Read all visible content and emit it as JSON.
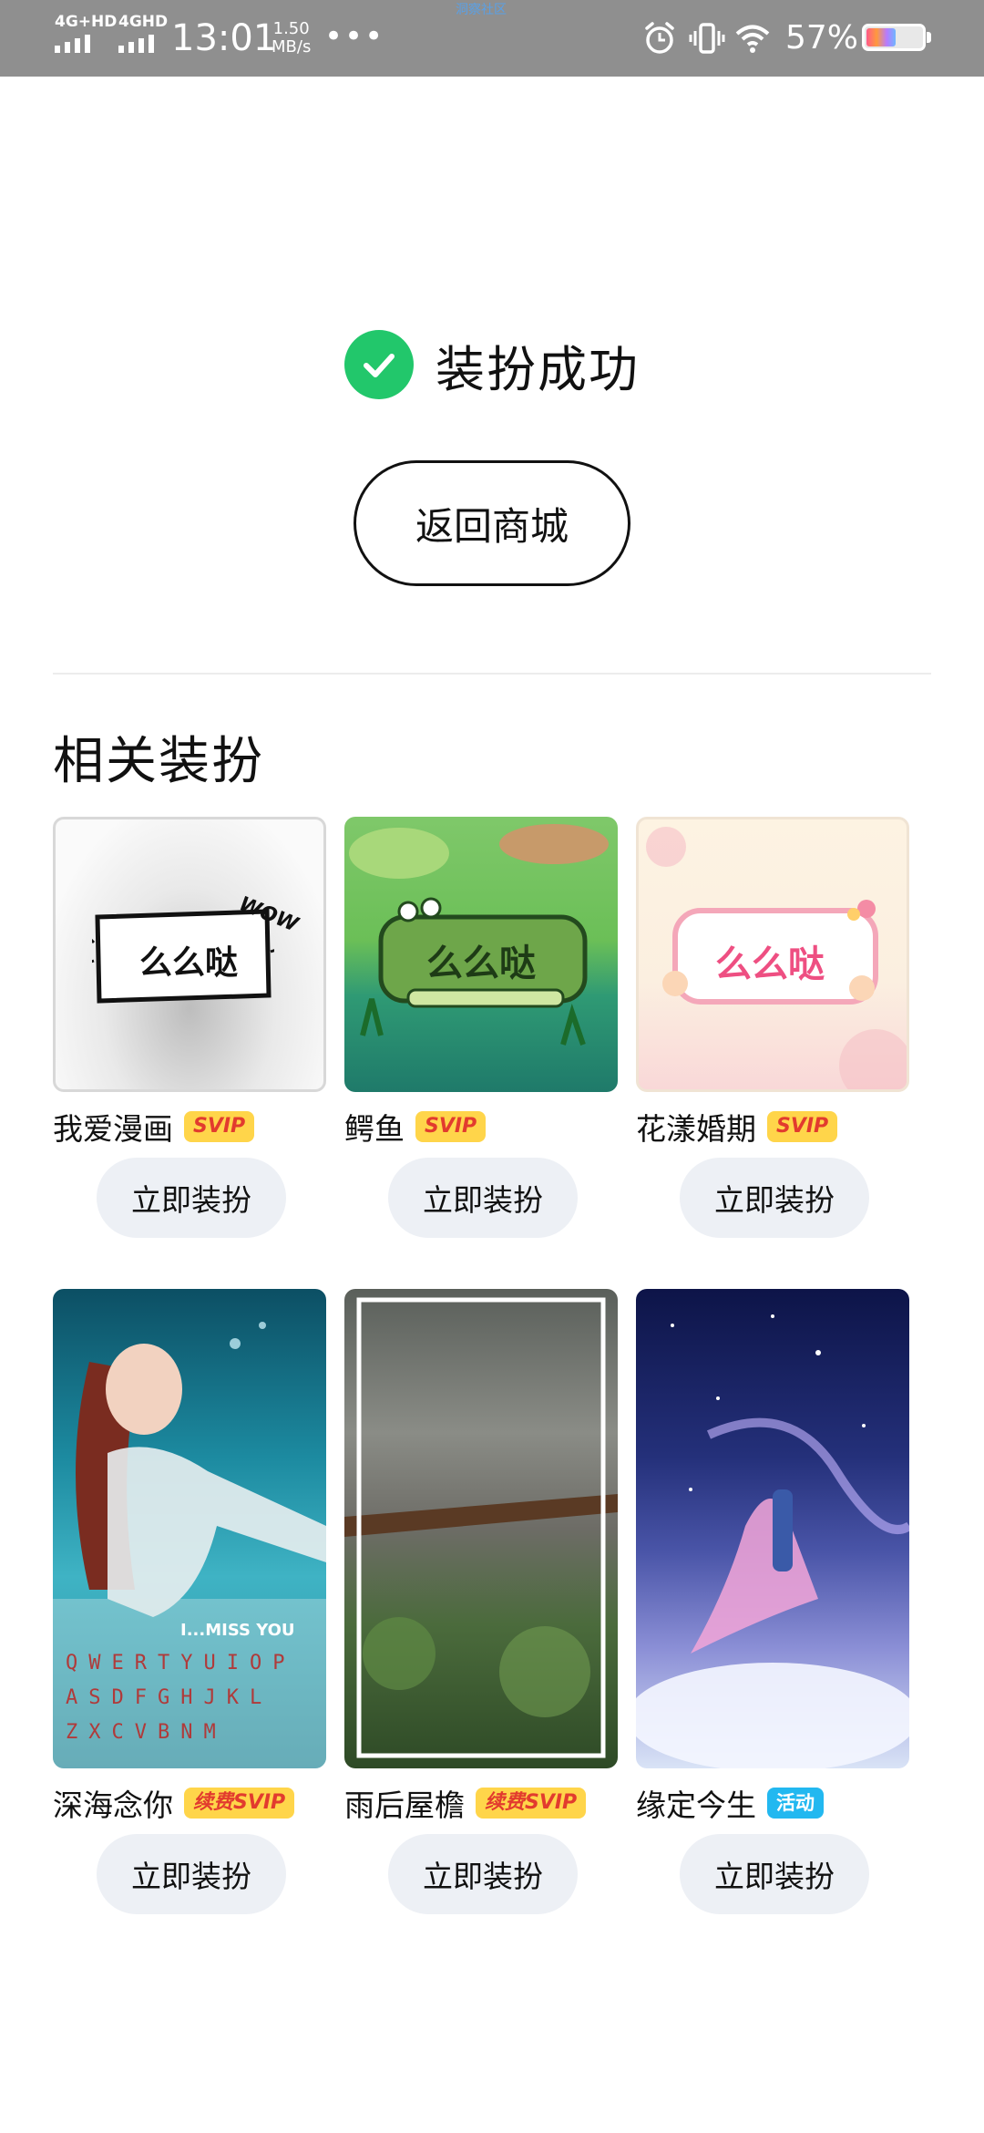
{
  "status_bar": {
    "network1": "4G+HD",
    "network2": "4GHD",
    "time": "13:01",
    "speed_value": "1.50",
    "speed_unit": "MB/s",
    "dots": "•••",
    "tiny_text": "洞察社区",
    "battery_percent": "57%",
    "battery_level": 0.57
  },
  "success": {
    "message": "装扮成功",
    "back_button": "返回商城"
  },
  "section_title": "相关装扮",
  "items": [
    {
      "name": "我爱漫画",
      "badge": "SVIP",
      "badge_type": "svip",
      "bubble_text": "么么哒",
      "sticker": "WOW",
      "button": "立即装扮"
    },
    {
      "name": "鳄鱼",
      "badge": "SVIP",
      "badge_type": "svip",
      "bubble_text": "么么哒",
      "button": "立即装扮"
    },
    {
      "name": "花漾婚期",
      "badge": "SVIP",
      "badge_type": "svip",
      "bubble_text": "么么哒",
      "button": "立即装扮"
    },
    {
      "name": "深海念你",
      "badge": "续费SVIP",
      "badge_type": "svip",
      "overlay_text": "I...MISS YOU",
      "keyboard_rows": [
        "QWERTYUIOP",
        "ASDFGHJKL",
        "ZXCVBNM"
      ],
      "button": "立即装扮"
    },
    {
      "name": "雨后屋檐",
      "badge": "续费SVIP",
      "badge_type": "svip",
      "button": "立即装扮"
    },
    {
      "name": "缘定今生",
      "badge": "活动",
      "badge_type": "event",
      "button": "立即装扮"
    }
  ],
  "colors": {
    "status_bar_bg": "#8f8f8f",
    "success_green": "#22c76b",
    "svip_badge_bg": "#ffd54a",
    "svip_badge_text": "#e23b2e",
    "event_badge_bg": "#22b8f0",
    "apply_button_bg": "#edf0f5"
  }
}
